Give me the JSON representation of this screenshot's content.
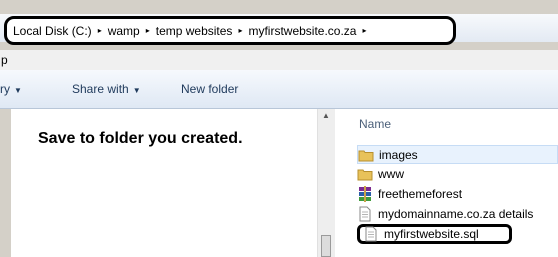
{
  "address": {
    "crumbs": [
      "Local Disk (C:)",
      "wamp",
      "temp websites",
      "myfirstwebsite.co.za"
    ],
    "separator": "▸"
  },
  "menu": {
    "partial_label": "p"
  },
  "toolbar": {
    "organize_partial": "ry",
    "share_with": "Share with",
    "new_folder": "New folder",
    "caret": "▼"
  },
  "left_pane": {
    "instruction": "Save to folder you created."
  },
  "right_pane": {
    "column_header": "Name",
    "files": [
      {
        "name": "images",
        "icon": "folder-icon"
      },
      {
        "name": "www",
        "icon": "folder-icon"
      },
      {
        "name": "freethemeforest",
        "icon": "winrar-archive-icon"
      },
      {
        "name": "mydomainname.co.za details",
        "icon": "text-document-icon"
      },
      {
        "name": "myfirstwebsite.sql",
        "icon": "text-document-icon"
      }
    ]
  },
  "colors": {
    "accent": "#1e395b",
    "folder": "#e8c25a",
    "annotation_outline": "#000000"
  }
}
